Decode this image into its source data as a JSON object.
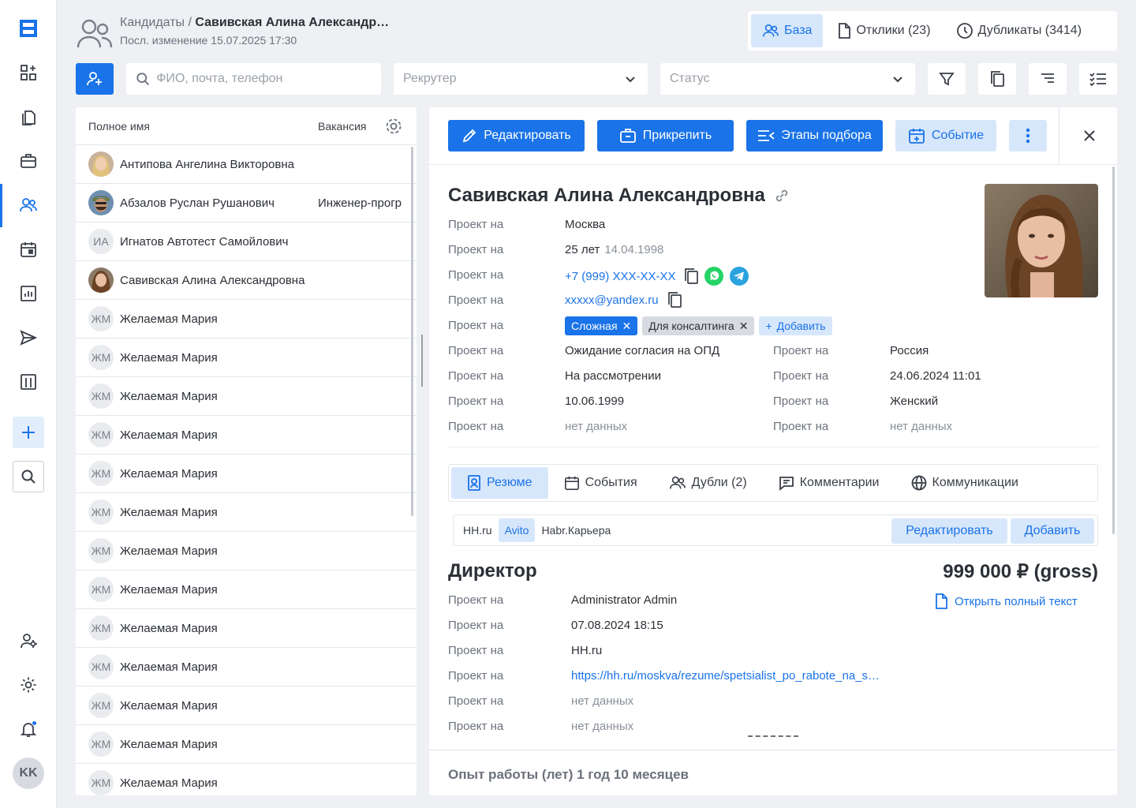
{
  "header": {
    "breadcrumb_section": "Кандидаты",
    "breadcrumb_separator": " / ",
    "breadcrumb_current": "Савивская Алина Александр…",
    "last_modified": "Посл. изменение 15.07.2025 17:30"
  },
  "top_tabs": [
    {
      "label": "База",
      "icon": "users-icon",
      "active": true
    },
    {
      "label": "Отклики (23)",
      "icon": "document-icon",
      "active": false
    },
    {
      "label": "Дубликаты (3414)",
      "icon": "clock-icon",
      "active": false
    }
  ],
  "toolbar": {
    "search_placeholder": "ФИО, почта, телефон",
    "recruiter_placeholder": "Рекрутер",
    "status_placeholder": "Статус"
  },
  "list": {
    "col_name": "Полное имя",
    "col_vacancy": "Вакансия",
    "rows": [
      {
        "initials": "",
        "photo": "blonde",
        "name": "Антипова Ангелина Викторовна",
        "vacancy": ""
      },
      {
        "initials": "",
        "photo": "man",
        "name": "Абзалов Руслан Рушанович",
        "vacancy": "Инженер-прогр"
      },
      {
        "initials": "ИА",
        "photo": "",
        "name": "Игнатов Автотест Самойлович",
        "vacancy": ""
      },
      {
        "initials": "",
        "photo": "brunette",
        "name": "Савивская Алина Александровна",
        "vacancy": ""
      },
      {
        "initials": "ЖМ",
        "photo": "",
        "name": "Желаемая Мария",
        "vacancy": ""
      },
      {
        "initials": "ЖМ",
        "photo": "",
        "name": "Желаемая Мария",
        "vacancy": ""
      },
      {
        "initials": "ЖМ",
        "photo": "",
        "name": "Желаемая Мария",
        "vacancy": ""
      },
      {
        "initials": "ЖМ",
        "photo": "",
        "name": "Желаемая Мария",
        "vacancy": ""
      },
      {
        "initials": "ЖМ",
        "photo": "",
        "name": "Желаемая Мария",
        "vacancy": ""
      },
      {
        "initials": "ЖМ",
        "photo": "",
        "name": "Желаемая Мария",
        "vacancy": ""
      },
      {
        "initials": "ЖМ",
        "photo": "",
        "name": "Желаемая Мария",
        "vacancy": ""
      },
      {
        "initials": "ЖМ",
        "photo": "",
        "name": "Желаемая Мария",
        "vacancy": ""
      },
      {
        "initials": "ЖМ",
        "photo": "",
        "name": "Желаемая Мария",
        "vacancy": ""
      },
      {
        "initials": "ЖМ",
        "photo": "",
        "name": "Желаемая Мария",
        "vacancy": ""
      },
      {
        "initials": "ЖМ",
        "photo": "",
        "name": "Желаемая Мария",
        "vacancy": ""
      },
      {
        "initials": "ЖМ",
        "photo": "",
        "name": "Желаемая Мария",
        "vacancy": ""
      },
      {
        "initials": "ЖМ",
        "photo": "",
        "name": "Желаемая Мария",
        "vacancy": ""
      }
    ]
  },
  "actions": {
    "edit": "Редактировать",
    "attach": "Прикрепить",
    "stages": "Этапы подбора",
    "event": "Событие"
  },
  "candidate": {
    "name": "Савивская Алина Александровна",
    "field_label": "Проект на",
    "city": "Москва",
    "age": "25 лет",
    "birth_date": "14.04.1998",
    "phone": "+7 (999) XXX-XX-XX",
    "email": "xxxxx@yandex.ru",
    "tags": [
      "Сложная",
      "Для консалтинга"
    ],
    "add_tag": "Добавить",
    "pd_status": "Ожидание согласия на ОПД",
    "status": "На рассмотрении",
    "date2": "10.06.1999",
    "no_data": "нет данных",
    "country": "Россия",
    "created": "24.06.2024 11:01",
    "gender": "Женский"
  },
  "sub_tabs": [
    {
      "label": "Резюме",
      "icon": "resume-icon",
      "active": true
    },
    {
      "label": "События",
      "icon": "calendar-icon",
      "active": false
    },
    {
      "label": "Дубли (2)",
      "icon": "users-icon",
      "active": false
    },
    {
      "label": "Комментарии",
      "icon": "comment-icon",
      "active": false
    },
    {
      "label": "Коммуникации",
      "icon": "globe-icon",
      "active": false
    }
  ],
  "sources": {
    "items": [
      {
        "label": "HH.ru",
        "active": false
      },
      {
        "label": "Avito",
        "active": true
      },
      {
        "label": "Habr.Карьера",
        "active": false
      }
    ],
    "edit": "Редактировать",
    "add": "Добавить"
  },
  "resume": {
    "position": "Директор",
    "salary": "999 000 ₽ (gross)",
    "open_full": "Открыть полный текст",
    "author": "Administrator Admin",
    "date": "07.08.2024 18:15",
    "source": "HH.ru",
    "url": "https://hh.ru/moskva/rezume/spetsialist_po_rabote_na_s…",
    "no_data": "нет данных",
    "experience": "Опыт работы (лет) 1 год 10 месяцев"
  },
  "user": {
    "initials": "KK"
  },
  "colors": {
    "accent": "#1a73e8",
    "accent_light": "#d7e7fb",
    "background": "#eef0f3",
    "whatsapp": "#25d366",
    "telegram": "#2aa3e0"
  }
}
